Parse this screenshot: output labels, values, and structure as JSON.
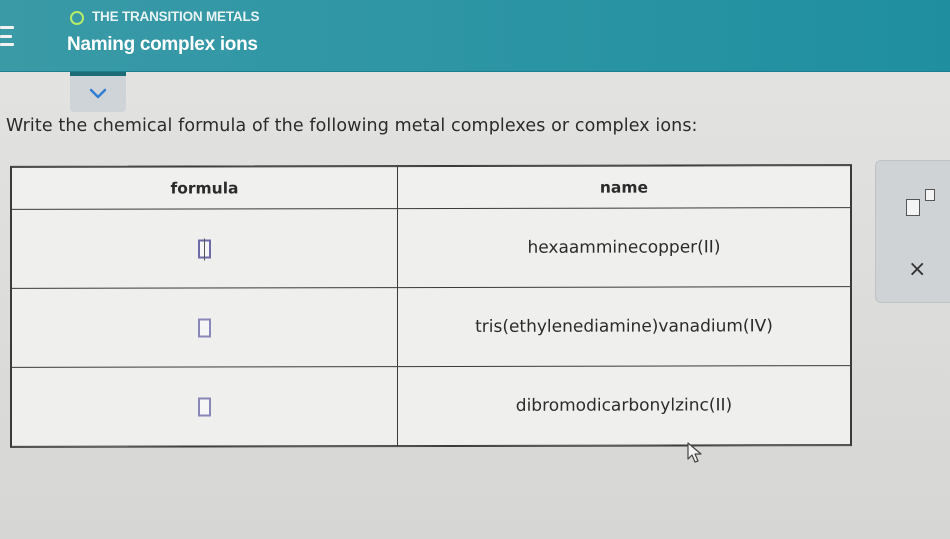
{
  "header": {
    "section": "THE TRANSITION METALS",
    "title": "Naming complex ions"
  },
  "instructions": "Write the chemical formula of the following metal complexes or complex ions:",
  "table": {
    "headers": {
      "formula": "formula",
      "name": "name"
    },
    "rows": [
      {
        "name": "hexaamminecopper(II)"
      },
      {
        "name": "tris(ethylenediamine)vanadium(IV)"
      },
      {
        "name": "dibromodicarbonylzinc(II)"
      }
    ]
  },
  "side_panel": {
    "superscript_icon": "superscript-box-icon",
    "clear_label": "×"
  },
  "icons": {
    "menu": "menu-icon",
    "status": "circle-icon",
    "expand": "chevron-down-icon",
    "cursor": "mouse-pointer-icon"
  },
  "colors": {
    "header": "#2f96a5",
    "status_ring": "#b6ec6a",
    "input_box": "#8a86b8"
  }
}
